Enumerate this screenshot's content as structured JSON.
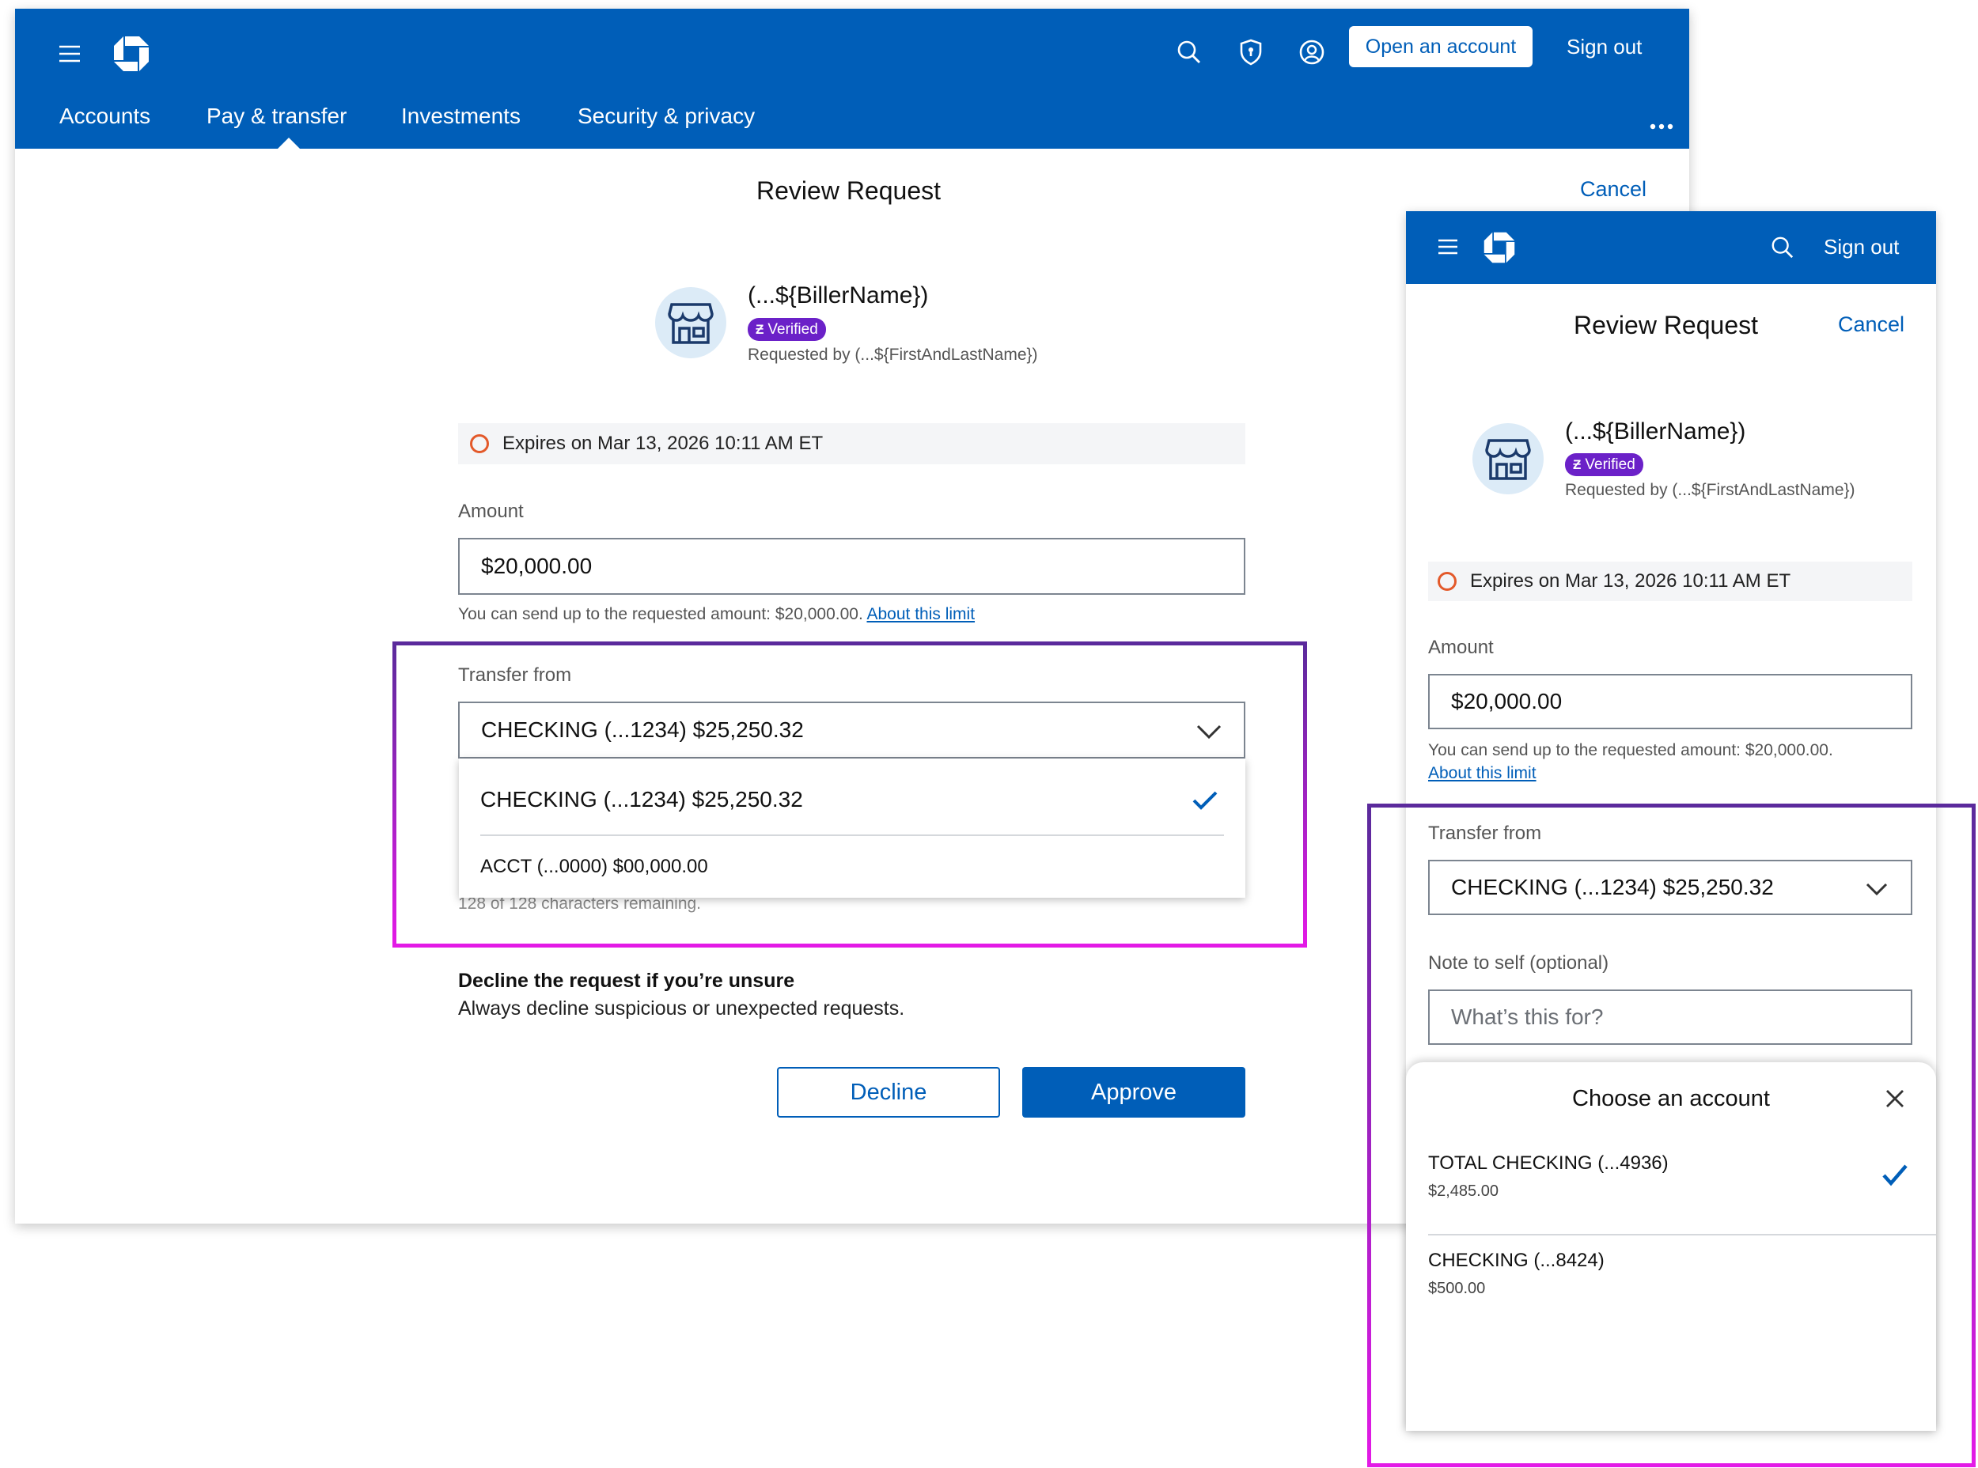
{
  "colors": {
    "brand_blue": "#005eb8",
    "verified_purple": "#6b21c8",
    "expiry_orange": "#e3592a",
    "highlight_start": "#5b2a9c",
    "highlight_end": "#e31ae6"
  },
  "desktop": {
    "header": {
      "icons": [
        "menu-icon",
        "chase-logo-icon",
        "search-icon",
        "shield-icon",
        "profile-icon"
      ],
      "open_account": "Open an account",
      "sign_out": "Sign out",
      "tabs": [
        "Accounts",
        "Pay & transfer",
        "Investments",
        "Security & privacy"
      ],
      "active_tab": "Pay & transfer",
      "more_icon": "more-dots-icon"
    },
    "title": "Review Request",
    "cancel": "Cancel",
    "biller": {
      "name": "(...${BillerName})",
      "verified": "Verified",
      "requested_by": "Requested by (...${FirstAndLastName})"
    },
    "expiry": "Expires on Mar 13, 2026 10:11 AM ET",
    "amount_label": "Amount",
    "amount_value": "$20,000.00",
    "amount_helper": "You can send up to the requested amount: $20,000.00.",
    "about_limit": "About this limit",
    "transfer_label": "Transfer from",
    "transfer_value": "CHECKING (...1234) $25,250.32",
    "dropdown_options": [
      "CHECKING (...1234) $25,250.32",
      "ACCT (...0000) $00,000.00"
    ],
    "chars_remaining": "128 of 128 characters remaining.",
    "decline_heading": "Decline the request if you’re unsure",
    "decline_sub": "Always decline suspicious or unexpected requests.",
    "decline_btn": "Decline",
    "approve_btn": "Approve"
  },
  "mobile": {
    "header": {
      "icons": [
        "menu-icon",
        "chase-logo-icon",
        "search-icon"
      ],
      "sign_out": "Sign out"
    },
    "title": "Review Request",
    "cancel": "Cancel",
    "biller": {
      "name": "(...${BillerName})",
      "verified": "Verified",
      "requested_by": "Requested by (...${FirstAndLastName})"
    },
    "expiry": "Expires on Mar 13, 2026 10:11 AM ET",
    "amount_label": "Amount",
    "amount_value": "$20,000.00",
    "amount_helper": "You can send up to the requested amount: $20,000.00.",
    "about_limit": "About this limit",
    "transfer_label": "Transfer from",
    "transfer_value": "CHECKING (...1234) $25,250.32",
    "note_label": "Note to self (optional)",
    "note_placeholder": "What’s this for?",
    "sheet": {
      "title": "Choose an account",
      "accounts": [
        {
          "name": "TOTAL CHECKING (...4936)",
          "balance": "$2,485.00",
          "selected": true
        },
        {
          "name": "CHECKING (...8424)",
          "balance": "$500.00",
          "selected": false
        }
      ]
    }
  }
}
